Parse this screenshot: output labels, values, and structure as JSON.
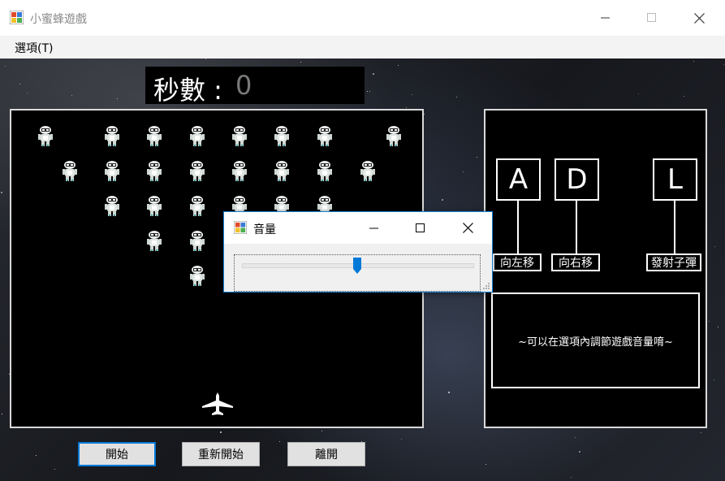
{
  "window": {
    "title": "小蜜蜂遊戲"
  },
  "menu": {
    "options_label": "選項(T)"
  },
  "hud": {
    "timer_label": "秒數 :",
    "timer_value": "0"
  },
  "controls": {
    "keys": [
      {
        "key": "A",
        "label": "向左移"
      },
      {
        "key": "D",
        "label": "向右移"
      },
      {
        "key": "L",
        "label": "發射子彈"
      }
    ],
    "hint": "~可以在選項內調節遊戲音量唷~"
  },
  "buttons": {
    "start": "開始",
    "restart": "重新開始",
    "exit": "離開"
  },
  "volume_dialog": {
    "title": "音量",
    "level": 0.5
  },
  "enemies": {
    "rows": [
      8,
      8,
      6,
      3,
      1
    ]
  },
  "colors": {
    "accent": "#0078d7",
    "panel_bg": "#000000",
    "timer_value": "#7a7a7a"
  }
}
